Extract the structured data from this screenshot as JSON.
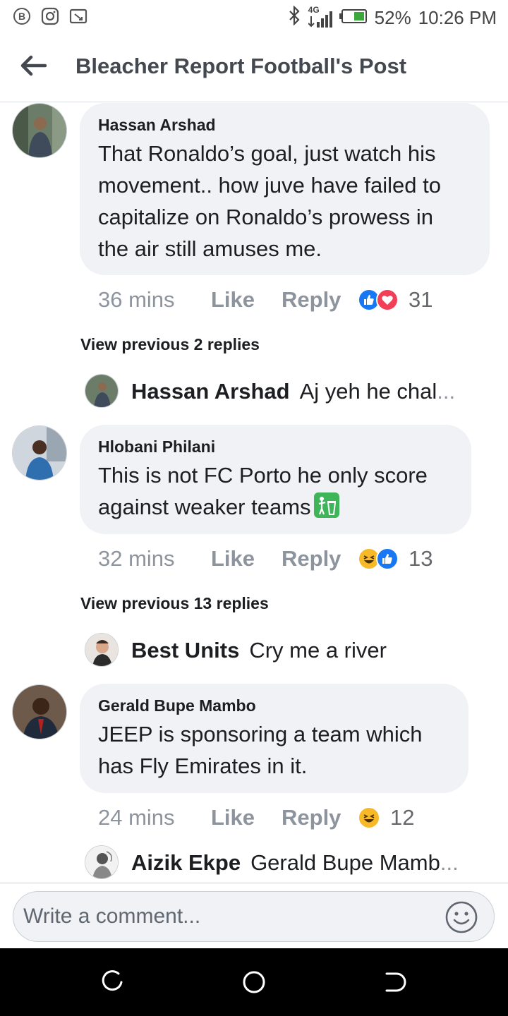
{
  "status_bar": {
    "left_icons": [
      "b-badge-icon",
      "instagram-icon",
      "screenshot-icon"
    ],
    "network": "4G",
    "battery": "52%",
    "time": "10:26 PM"
  },
  "header": {
    "title": "Bleacher Report Football's Post"
  },
  "comments": [
    {
      "author": "Hassan Arshad",
      "lines": [
        "That Ronaldo’s goal, just watch his",
        "movement.. how juve have failed to",
        "capitalize on Ronaldo’s prowess in",
        "the air still amuses me."
      ],
      "time": "36 mins",
      "like_label": "Like",
      "reply_label": "Reply",
      "reactions": [
        "like",
        "love"
      ],
      "reaction_count": "31",
      "view_previous": "View previous 2 replies",
      "last_reply": {
        "author": "Hassan Arshad",
        "text": "Aj yeh he chal",
        "ellipsis": "..."
      }
    },
    {
      "author": "Hlobani Philani",
      "lines": [
        "This is not FC Porto he only score",
        "against weaker teams"
      ],
      "time": "32 mins",
      "like_label": "Like",
      "reply_label": "Reply",
      "reactions": [
        "haha",
        "like"
      ],
      "reaction_count": "13",
      "view_previous": "View previous 13 replies",
      "last_reply": {
        "author": "Best Units",
        "text": "Cry me a river",
        "ellipsis": ""
      }
    },
    {
      "author": "Gerald Bupe Mambo",
      "lines": [
        "JEEP is sponsoring a team which",
        "has Fly Emirates in it."
      ],
      "time": "24 mins",
      "like_label": "Like",
      "reply_label": "Reply",
      "reactions": [
        "haha"
      ],
      "reaction_count": "12",
      "last_reply": {
        "author": "Aizik Ekpe",
        "text": "Gerald Bupe Mamb",
        "ellipsis": "..."
      }
    }
  ],
  "composer": {
    "placeholder": "Write a comment..."
  },
  "colors": {
    "bubble": "#f0f2f5",
    "like_blue": "#1877f2",
    "love_red": "#f33e58",
    "haha_yellow": "#f7b928",
    "muted_text": "#8d949e"
  }
}
